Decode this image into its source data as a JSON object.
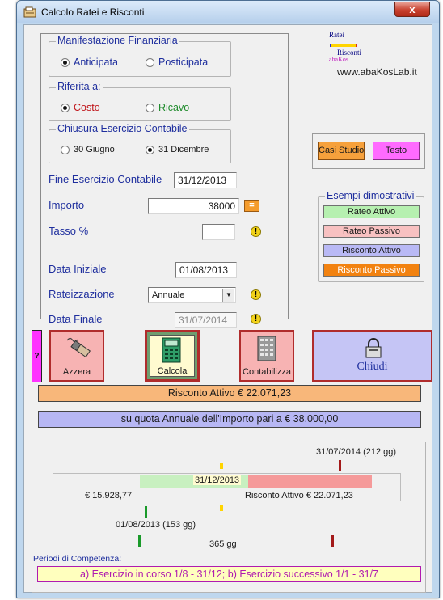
{
  "window": {
    "title": "Calcolo Ratei e Risconti",
    "close_label": "x"
  },
  "logo": {
    "line1": "Ratei",
    "line2": "Risconti",
    "line3": "abaKos",
    "site": "www.abaKosLab.it"
  },
  "manifestazione": {
    "legend": "Manifestazione Finanziaria",
    "options": [
      "Anticipata",
      "Posticipata"
    ],
    "selected": "Anticipata"
  },
  "riferita": {
    "legend": "Riferita a:",
    "options": [
      "Costo",
      "Ricavo"
    ],
    "selected": "Costo"
  },
  "chiusura": {
    "legend": "Chiusura Esercizio Contabile",
    "options": [
      "30 Giugno",
      "31 Dicembre"
    ],
    "selected": "31 Dicembre"
  },
  "form": {
    "fine_esercizio_label": "Fine Esercizio Contabile",
    "fine_esercizio_value": "31/12/2013",
    "importo_label": "Importo",
    "importo_value": "38000",
    "equals_label": "=",
    "tasso_label": "Tasso %",
    "tasso_value": "",
    "data_iniziale_label": "Data Iniziale",
    "data_iniziale_value": "01/08/2013",
    "rateizzazione_label": "Rateizzazione",
    "rateizzazione_value": "Annuale",
    "data_finale_label": "Data Finale",
    "data_finale_value": "31/07/2014",
    "warn_glyph": "!"
  },
  "right_buttons": {
    "casi_studio": "Casi Studio",
    "testo": "Testo"
  },
  "esempi": {
    "legend": "Esempi dimostrativi",
    "items": [
      "Rateo Attivo",
      "Rateo Passivo",
      "Risconto Attivo",
      "Risconto Passivo"
    ]
  },
  "actions": {
    "help": "?",
    "azzera": "Azzera",
    "calcola": "Calcola",
    "contabilizza": "Contabilizza",
    "chiudi": "Chiudi"
  },
  "results": {
    "risconto": "Risconto Attivo  € 22.071,23",
    "quota": "su quota Annuale dell'Importo pari a € 38.000,00"
  },
  "timeline": {
    "end_label": "31/07/2014 (212 gg)",
    "closing_date": "31/12/2013",
    "left_amount": "€ 15.928,77",
    "right_amount": "Risconto Attivo € 22.071,23",
    "start_label": "01/08/2013 (153 gg)",
    "total_days": "365 gg",
    "days_first": 153,
    "days_second": 212
  },
  "periodi": {
    "label": "Periodi di Competenza:",
    "text": "a) Esercizio in corso 1/8 - 31/12;  b) Esercizio successivo 1/1 - 31/7"
  },
  "colors": {
    "orange": "#f8b77a",
    "lavender": "#b7b7f4",
    "yellow": "#ffffbe",
    "green_bar": "#c8f0c0",
    "red_bar": "#f59a9a",
    "magenta": "#ff66ff"
  }
}
